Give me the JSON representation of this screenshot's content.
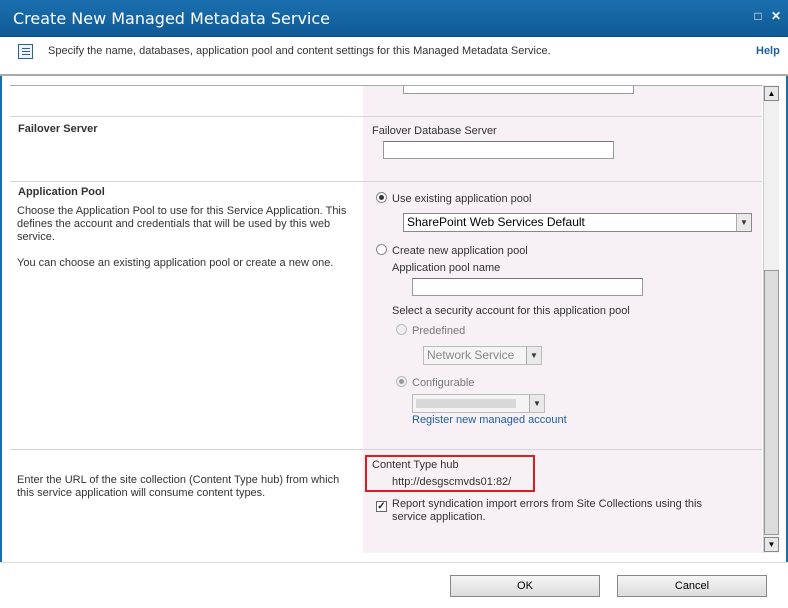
{
  "window": {
    "title": "Create New Managed Metadata Service",
    "maximize_glyph": "□",
    "close_glyph": "✕"
  },
  "infobar": {
    "description": "Specify the name, databases, application pool and content settings for this Managed Metadata Service.",
    "help_label": "Help"
  },
  "failover": {
    "heading": "Failover Server",
    "field_label": "Failover Database Server",
    "field_value": ""
  },
  "app_pool": {
    "heading": "Application Pool",
    "desc1": "Choose the Application Pool to use for this Service Application.  This defines the account and credentials that will be used by this web service.",
    "desc2": "You can choose an existing application pool or create a new one.",
    "use_existing_label": "Use existing application pool",
    "existing_selected": "SharePoint Web Services Default",
    "create_new_label": "Create new application pool",
    "pool_name_label": "Application pool name",
    "pool_name_value": "",
    "security_label": "Select a security account for this application pool",
    "predefined_label": "Predefined",
    "predefined_selected": "Network Service",
    "configurable_label": "Configurable",
    "register_link": "Register new managed account"
  },
  "hub": {
    "description": "Enter the URL of the site collection (Content Type hub) from which this service application will consume content types.",
    "label": "Content Type hub",
    "url": "http://desgscmvds01:82/",
    "report_errors_label": "Report syndication import errors from Site Collections using this service application.",
    "report_errors_checked": true
  },
  "buttons": {
    "ok": "OK",
    "cancel": "Cancel"
  },
  "colors": {
    "titlebar": "#1b6fae",
    "highlight_box": "#d91e1e",
    "right_panel": "#f7f0f5"
  }
}
